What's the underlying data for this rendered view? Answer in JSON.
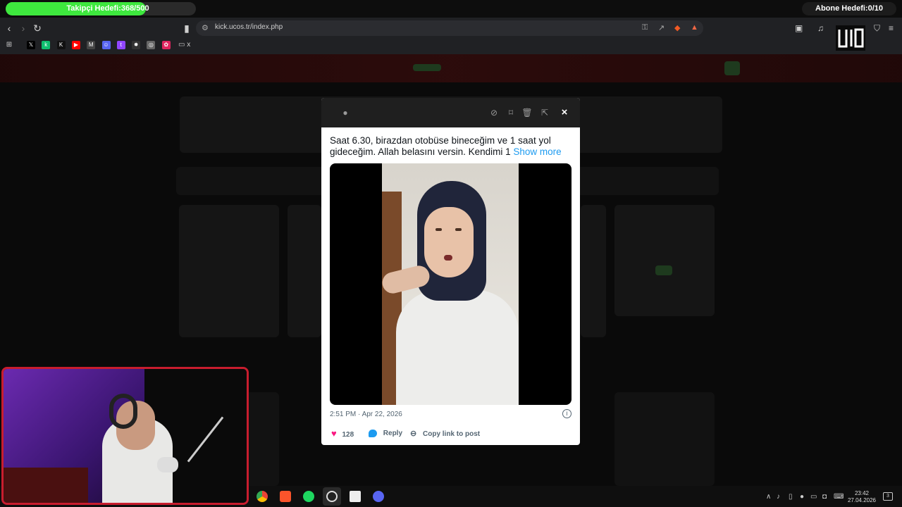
{
  "overlay": {
    "follower_goal": "Takipçi Hedefi:368/500",
    "follower_progress": 0.736,
    "subscriber_goal": "Abone Hedefi:0/10"
  },
  "browser": {
    "url": "kick.ucos.tr/index.php",
    "bookmarks": [
      {
        "icon": "x-icon",
        "color": "#000000",
        "glyph": "𝕏"
      },
      {
        "icon": "kick-icon",
        "color": "#0fbf6f",
        "glyph": "k"
      },
      {
        "icon": "kick-k-icon",
        "color": "#111111",
        "glyph": "K"
      },
      {
        "icon": "youtube-icon",
        "color": "#ff0000",
        "glyph": "▶"
      },
      {
        "icon": "gmail-icon",
        "color": "#444444",
        "glyph": "M"
      },
      {
        "icon": "discord-icon",
        "color": "#5865f2",
        "glyph": "☺"
      },
      {
        "icon": "twitch-icon",
        "color": "#9146ff",
        "glyph": "t"
      },
      {
        "icon": "star-icon",
        "color": "#333333",
        "glyph": "✸"
      },
      {
        "icon": "circle-icon",
        "color": "#666666",
        "glyph": "◎"
      },
      {
        "icon": "flower-icon",
        "color": "#e0245e",
        "glyph": "✿"
      }
    ],
    "folder_label": "x"
  },
  "tweet": {
    "text": "Saat 6.30, birazdan otobüse bineceğim ve 1 saat yol gideceğim. Allah belasını versin. Kendimi 1",
    "show_more": "Show more",
    "timestamp": "2:51 PM · Apr 22, 2026",
    "likes": "128",
    "reply_label": "Reply",
    "copy_link_label": "Copy link to post"
  },
  "taskbar": {
    "time": "23:42",
    "date": "27.04.2026",
    "notifications": "3"
  },
  "colors": {
    "progress_green": "#3ee83e",
    "cam_border": "#c81d2e",
    "link_blue": "#1d9bf0",
    "like_pink": "#f91880"
  }
}
